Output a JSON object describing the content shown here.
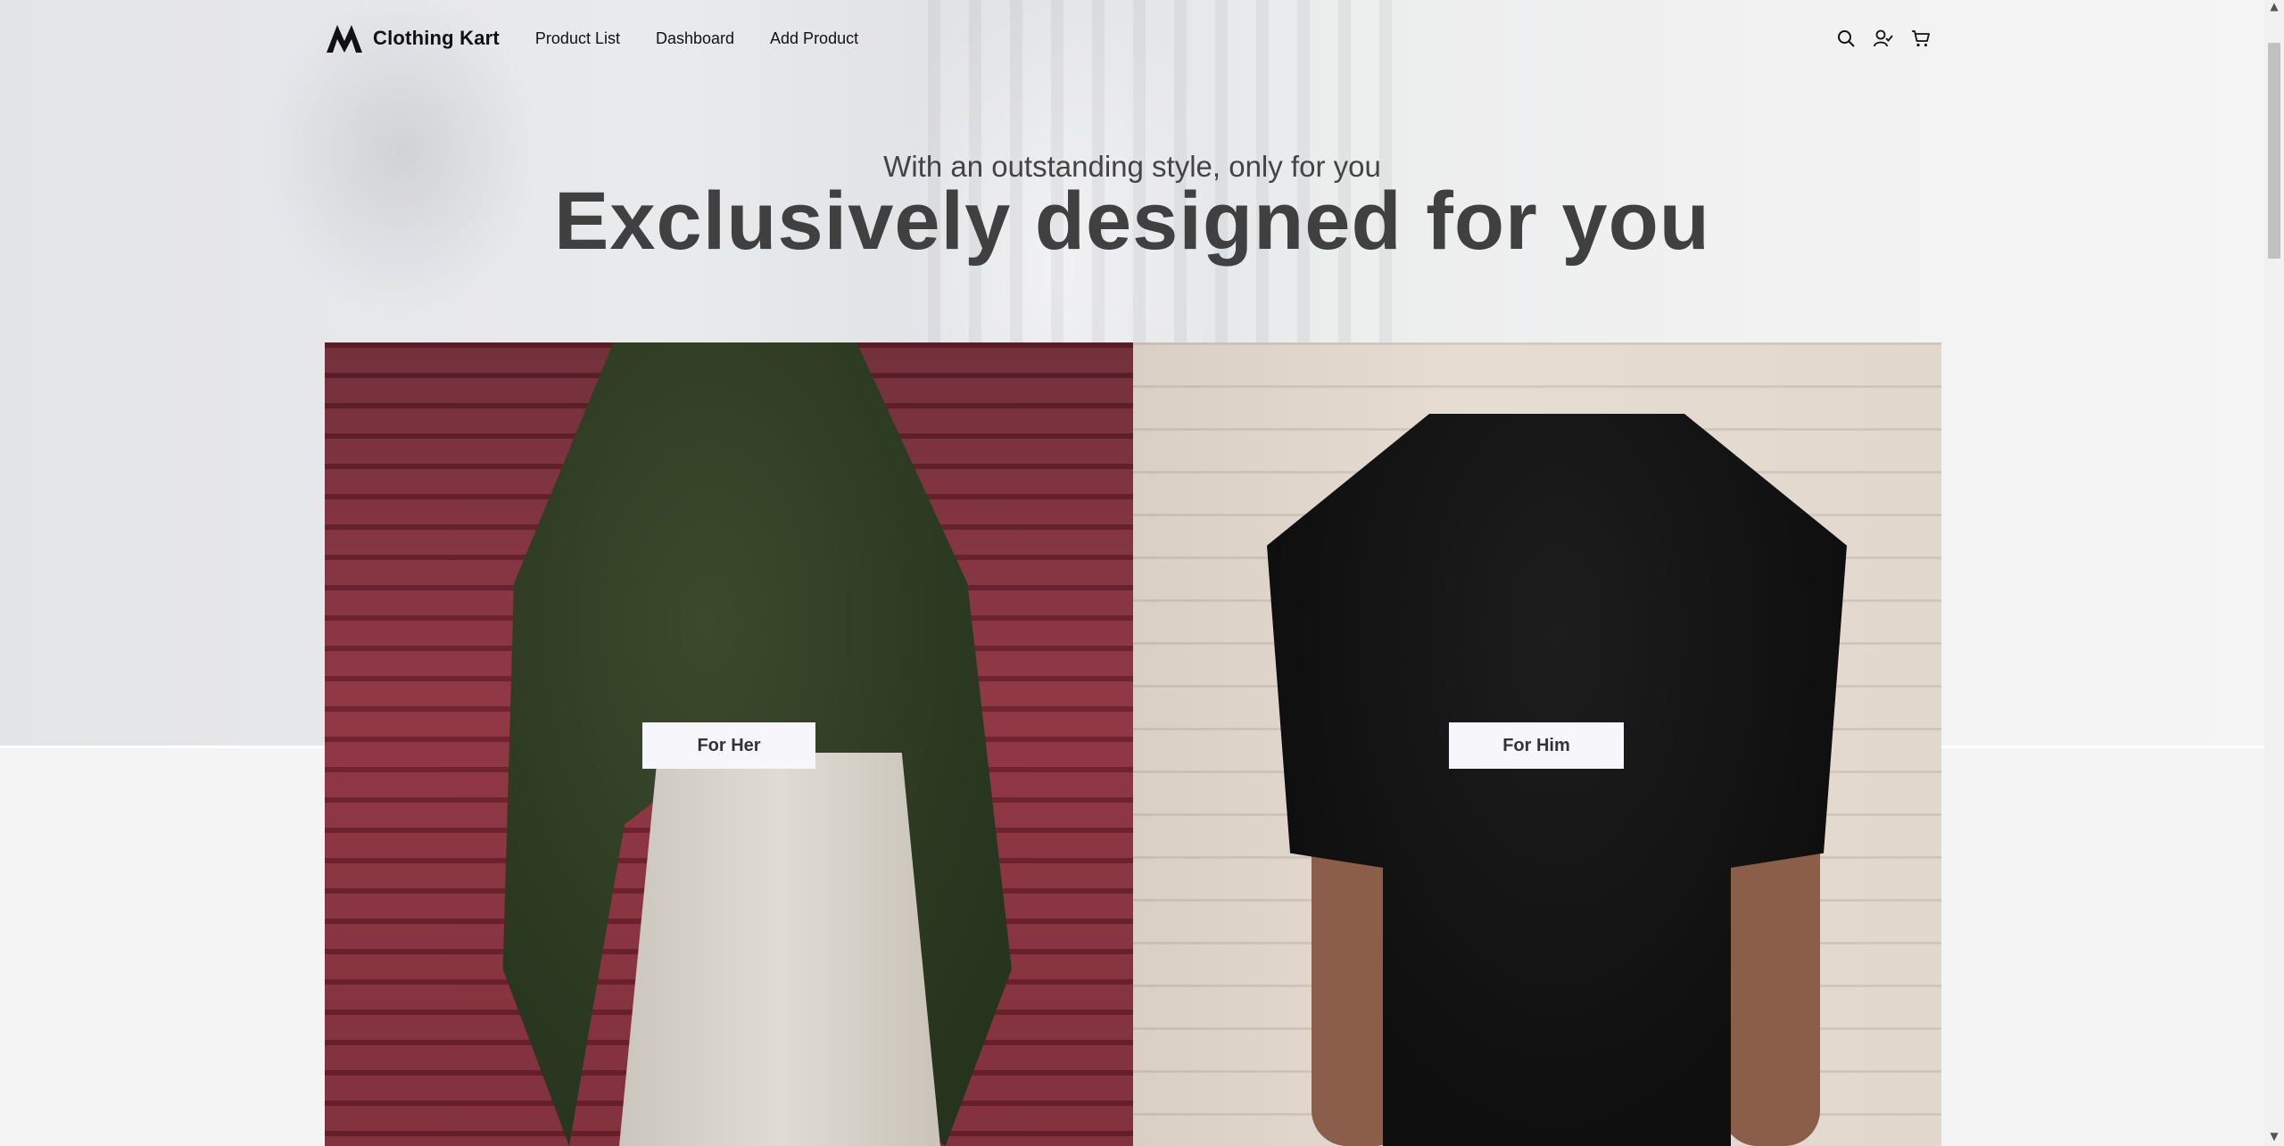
{
  "brand": {
    "name": "Clothing Kart",
    "logo_icon": "logo-m-icon"
  },
  "nav": {
    "links": [
      {
        "label": "Product List"
      },
      {
        "label": "Dashboard"
      },
      {
        "label": "Add Product"
      }
    ],
    "icons": [
      "search-icon",
      "user-icon",
      "cart-icon"
    ]
  },
  "hero": {
    "subtitle": "With an outstanding style, only for you",
    "headline": "Exclusively designed for you"
  },
  "panels": {
    "her": {
      "button_label": "For Her"
    },
    "him": {
      "button_label": "For Him"
    }
  },
  "colors": {
    "headline": "#404040",
    "button_bg": "#f7f7fb",
    "page_bg": "#f4f4f4"
  }
}
